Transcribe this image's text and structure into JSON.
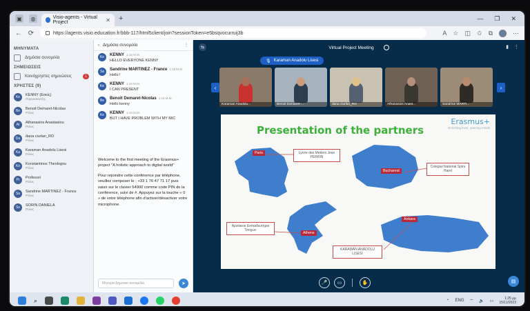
{
  "browser": {
    "tab_title": "Visio-agents - Virtual Project",
    "url": "https://agents.visio.education.fr/bbb-117/html5client/join?sessionToken=e5bsqvocurruij3b",
    "window_controls": [
      "—",
      "❐",
      "✕"
    ]
  },
  "left_panel": {
    "messages_title": "ΜΗΝΥΜΑΤΑ",
    "public_chat": "Δημόσια συνομιλία",
    "notes_title": "ΣΗΜΕΙΩΣΕΙΣ",
    "shared_notes": "Κοινόχρηστες σημειώσεις",
    "notes_badge": "1",
    "users_title": "ΧΡΗΣΤΕΣ (9)",
    "users": [
      {
        "initials": "Ke",
        "name": "KENNY (Εσείς)",
        "role": "Παρουσιαστής"
      },
      {
        "initials": "Be",
        "name": "Benoit Demaret-Nicolas",
        "role": "Ρόλος"
      },
      {
        "initials": "At",
        "name": "Athanasios Anastasiou",
        "role": "Ρόλος"
      },
      {
        "initials": "Da",
        "name": "dana ciurlan_RO",
        "role": "Ρόλος"
      },
      {
        "initials": "Ka",
        "name": "Karaman Anadolu Lisesi",
        "role": "Ρόλος"
      },
      {
        "initials": "Ko",
        "name": "Konstantinos Theologou",
        "role": "Ρόλος"
      },
      {
        "initials": "Pr",
        "name": "Profesori",
        "role": "Ρόλος"
      },
      {
        "initials": "Sa",
        "name": "Sandrine MARTINEZ - France",
        "role": "Ρόλος"
      },
      {
        "initials": "So",
        "name": "SORIN DANIELA",
        "role": "Ρόλος"
      }
    ]
  },
  "chat": {
    "header": "Δημόσια συνομιλία",
    "messages": [
      {
        "initials": "Ke",
        "who": "KENNY",
        "time": "1:18 Μ.Μ.",
        "text": "HELLO EVERYONE KENNY"
      },
      {
        "initials": "Sa",
        "who": "Sandrine MARTINEZ - France",
        "time": "1:18 Μ.Μ.",
        "text": "Hello !"
      },
      {
        "initials": "Ke",
        "who": "KENNY",
        "time": "1:19 Μ.Μ.",
        "text": "I CAN PRESENT"
      },
      {
        "initials": "Be",
        "who": "Benoit Demaret-Nicolas",
        "time": "1:19 Μ.Μ.",
        "text": "Hello kenny"
      },
      {
        "initials": "Ke",
        "who": "KENNY",
        "time": "1:19 Μ.Μ.",
        "text": "BUT I HAVE PROBLEM WITH MY MIC"
      }
    ],
    "welcome_1": "Welcome to the first meeting of the Erasmus+ project \"A holistic approach to digital world\"",
    "welcome_2": "Pour rejoindre cette conférence par téléphone, veuillez composer le : +33 1 76 47 71 17 puis saisir sur le clavier 54900 comme code PIN de la conférence, suivi de #. Appuyez sur la touche « 0 » de votre téléphone afin d'activer/désactiver votre microphone.",
    "input_placeholder": "Μήνυμα Δημόσια συνομιλία"
  },
  "meeting": {
    "title": "Virtual Project Meeting",
    "speaker": "Karaman Anadolu Lisesi",
    "videos": [
      {
        "label": "Karaman Anadolu..."
      },
      {
        "label": "Benoit Demaret-..."
      },
      {
        "label": "dana ciurlan_RO"
      },
      {
        "label": "Athanasios Anast..."
      },
      {
        "label": "Sandrine MARTI..."
      }
    ]
  },
  "slide": {
    "title": "Presentation of the partners",
    "logo": "Erasmus+",
    "logo_sub": "Enriching lives, opening minds",
    "boxes": [
      {
        "text": "Lycée des Metiers Jean PERRIN"
      },
      {
        "text": "Colegiul National Spiru Haret"
      },
      {
        "text": "Αρσάκειο Εκπαιδευτήριο Τσοχών"
      },
      {
        "text": "KARAMAN ANADOLU LISESI"
      }
    ],
    "cities": [
      "Paris",
      "Bucharest",
      "Athens",
      "Ankara"
    ]
  },
  "taskbar": {
    "lang": "ENG",
    "time": "1:25 μμ",
    "date": "15/11/2023"
  },
  "colors": {
    "meeting_bg": "#062c4a",
    "accent": "#1e5fc3",
    "slide_title": "#3db03a"
  }
}
